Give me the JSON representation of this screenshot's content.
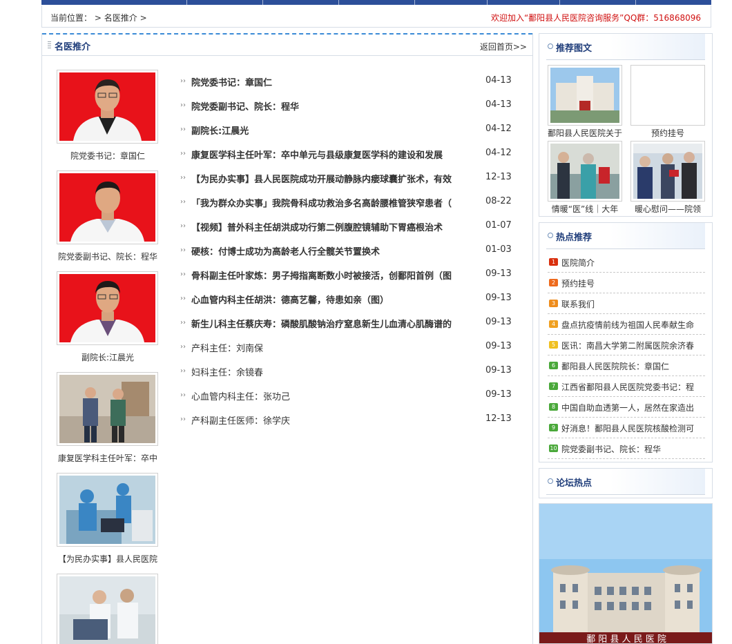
{
  "breadcrumb": {
    "label": "当前位置：",
    "sep1": ">",
    "current": "名医推介",
    "sep2": ">"
  },
  "welcome": "欢迎加入“鄱阳县人民医院咨询服务”QQ群：516868096",
  "section": {
    "title": "名医推介",
    "back": "返回首页>>"
  },
  "doctors": [
    {
      "caption": "院党委书记：章国仁"
    },
    {
      "caption": "院党委副书记、院长：程华"
    },
    {
      "caption": "副院长:江晨光"
    },
    {
      "caption": "康复医学科主任叶军：卒中"
    },
    {
      "caption": "【为民办实事】县人民医院"
    },
    {
      "caption": ""
    }
  ],
  "articles": [
    {
      "title": "院党委书记：章国仁",
      "date": "04-13",
      "bold": true
    },
    {
      "title": "院党委副书记、院长：程华",
      "date": "04-13",
      "bold": true
    },
    {
      "title": "副院长:江晨光",
      "date": "04-12",
      "bold": true
    },
    {
      "title": "康复医学科主任叶军：卒中单元与县级康复医学科的建设和发展",
      "date": "04-12",
      "bold": true
    },
    {
      "title": "【为民办实事】县人民医院成功开展动静脉内瘘球囊扩张术，有效",
      "date": "12-13",
      "bold": true
    },
    {
      "title": "「我为群众办实事」我院骨科成功救治多名高龄腰椎管狭窄患者（",
      "date": "08-22",
      "bold": true
    },
    {
      "title": "【视频】普外科主任胡洪成功行第二例腹腔镜辅助下胃癌根治术",
      "date": "01-07",
      "bold": true
    },
    {
      "title": "硬核：付博士成功为高龄老人行全髋关节置换术",
      "date": "01-03",
      "bold": true
    },
    {
      "title": "骨科副主任叶家炼：男子拇指离断数小时被接活，创鄱阳首例（图",
      "date": "09-13",
      "bold": true
    },
    {
      "title": "心血管内科主任胡洪：德高艺馨，待患如亲（图）",
      "date": "09-13",
      "bold": true
    },
    {
      "title": "新生儿科主任蔡庆寿：磷酸肌酸钠治疗窒息新生儿血清心肌酶谱的",
      "date": "09-13",
      "bold": true
    },
    {
      "title": "产科主任：刘南保",
      "date": "09-13",
      "bold": false
    },
    {
      "title": "妇科主任：余镜春",
      "date": "09-13",
      "bold": false
    },
    {
      "title": "心血管内科主任：张功己",
      "date": "09-13",
      "bold": false
    },
    {
      "title": "产科副主任医师：徐学庆",
      "date": "12-13",
      "bold": false
    }
  ],
  "recommend": {
    "title": "推荐图文",
    "items": [
      {
        "caption": "鄱阳县人民医院关于"
      },
      {
        "caption": "预约挂号"
      },
      {
        "caption": "情暖“医”线｜大年"
      },
      {
        "caption": "暖心慰问——院领"
      }
    ]
  },
  "hot": {
    "title": "热点推荐",
    "items": [
      {
        "num": "1",
        "text": "医院简介",
        "color": "#d9300e"
      },
      {
        "num": "2",
        "text": "预约挂号",
        "color": "#ee6a1c"
      },
      {
        "num": "3",
        "text": "联系我们",
        "color": "#ee8c1c"
      },
      {
        "num": "4",
        "text": "盘点抗疫情前线为祖国人民奉献生命",
        "color": "#f0a020"
      },
      {
        "num": "5",
        "text": "医讯：南昌大学第二附属医院余济春",
        "color": "#f0c020"
      },
      {
        "num": "6",
        "text": "鄱阳县人民医院院长：章国仁",
        "color": "#4aa83a"
      },
      {
        "num": "7",
        "text": "江西省鄱阳县人民医院党委书记：程",
        "color": "#4aa83a"
      },
      {
        "num": "8",
        "text": "中国自助血透第一人，居然在家造出",
        "color": "#4aa83a"
      },
      {
        "num": "9",
        "text": "好消息！鄱阳县人民医院核酸检测可",
        "color": "#4aa83a"
      },
      {
        "num": "10",
        "text": "院党委副书记、院长：程华",
        "color": "#4aa83a"
      }
    ]
  },
  "forum": {
    "title": "论坛热点",
    "banner_text": "鄱 阳 县 人 民 医 院"
  }
}
